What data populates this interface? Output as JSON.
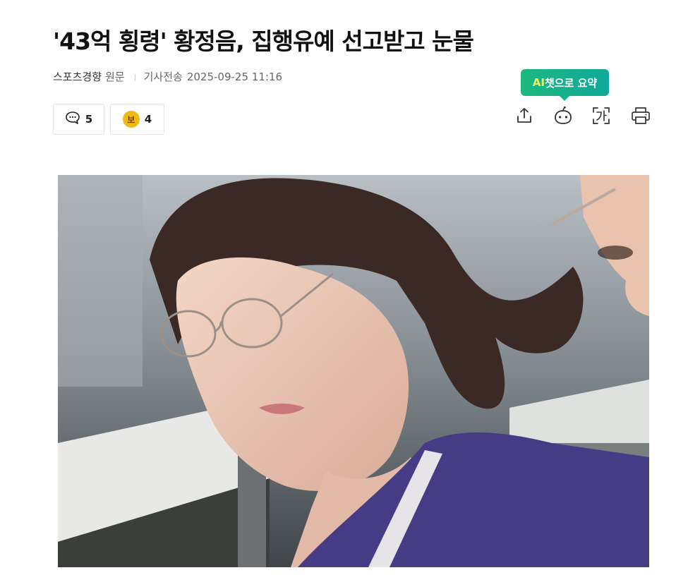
{
  "article": {
    "headline": "'43억 횡령' 황정음, 집행유예 선고받고 눈물",
    "source": "스포츠경향",
    "original_label": "원문",
    "sent_label": "기사전송",
    "sent_time": "2025-09-25 11:16"
  },
  "reactions": {
    "comments_count": "5",
    "badge_glyph": "보",
    "reactions_count": "4"
  },
  "tools": {
    "ai_tooltip_ai": "AI",
    "ai_tooltip_rest": "챗으로 요약",
    "icons": [
      "share-icon",
      "ai-chat-icon",
      "font-size-icon",
      "print-icon"
    ]
  },
  "colors": {
    "tooltip_green": "#1cb87e",
    "tooltip_ai_yellow": "#f5f35a",
    "badge_yellow": "#f2b816"
  }
}
